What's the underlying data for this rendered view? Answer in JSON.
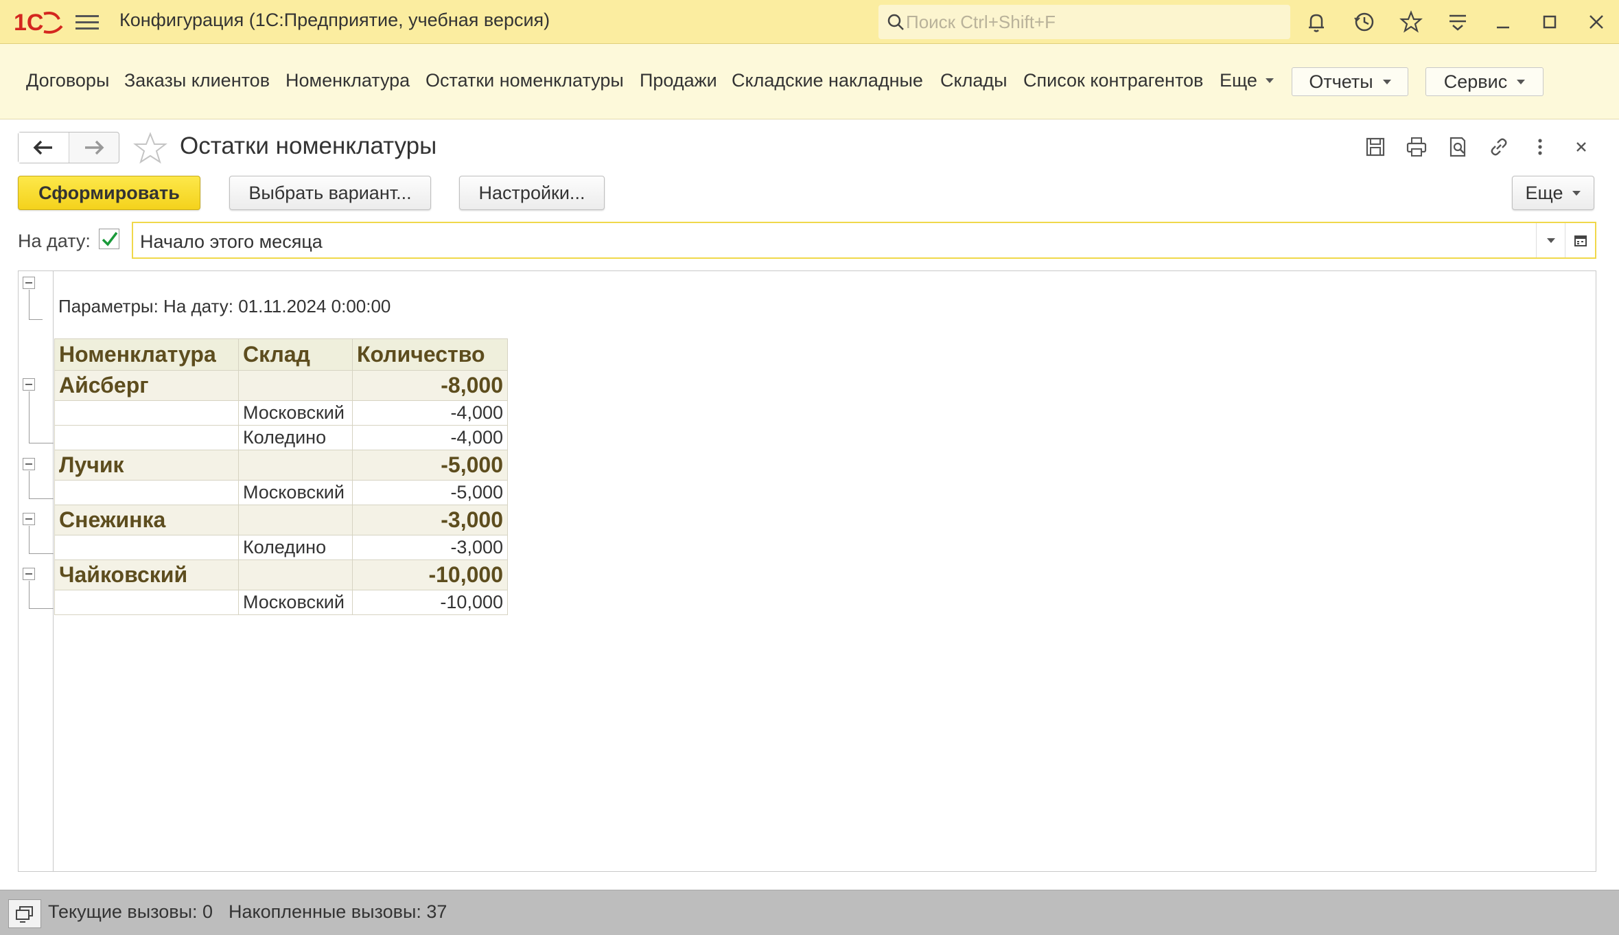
{
  "titlebar": {
    "logo_text": "1С",
    "app_title": "Конфигурация  (1С:Предприятие, учебная версия)",
    "search_placeholder": "Поиск Ctrl+Shift+F",
    "icons": [
      "bell-icon",
      "history-icon",
      "star-icon",
      "menu-lines-icon",
      "minimize-icon",
      "maximize-icon",
      "close-icon"
    ]
  },
  "sections": {
    "items": [
      "Договоры",
      "Заказы клиентов",
      "Номенклатура",
      "Остатки номенклатуры",
      "Продажи",
      "Складские накладные",
      "Склады",
      "Список контрагентов",
      "Еще"
    ],
    "reports_label": "Отчеты",
    "service_label": "Сервис"
  },
  "form": {
    "title": "Остатки номенклатуры",
    "generate_label": "Сформировать",
    "variant_label": "Выбрать вариант...",
    "settings_label": "Настройки...",
    "more_label": "Еще",
    "date_label": "На дату:",
    "date_checked": true,
    "date_value": "Начало этого месяца"
  },
  "report": {
    "params_text": "Параметры:  На дату: 01.11.2024 0:00:00",
    "headers": [
      "Номенклатура",
      "Склад",
      "Количество"
    ],
    "groups": [
      {
        "name": "Айсберг",
        "total": "-8,000",
        "rows": [
          {
            "warehouse": "Московский",
            "qty": "-4,000"
          },
          {
            "warehouse": "Коледино",
            "qty": "-4,000"
          }
        ]
      },
      {
        "name": "Лучик",
        "total": "-5,000",
        "rows": [
          {
            "warehouse": "Московский",
            "qty": "-5,000"
          }
        ]
      },
      {
        "name": "Снежинка",
        "total": "-3,000",
        "rows": [
          {
            "warehouse": "Коледино",
            "qty": "-3,000"
          }
        ]
      },
      {
        "name": "Чайковский",
        "total": "-10,000",
        "rows": [
          {
            "warehouse": "Московский",
            "qty": "-10,000"
          }
        ]
      }
    ]
  },
  "statusbar": {
    "current_calls": "Текущие вызовы: 0",
    "accumulated_calls": "Накопленные вызовы: 37"
  },
  "colors": {
    "titlebar_bg": "#fbeda0",
    "sections_bg": "#fdf9da",
    "primary_button": "#f4d21c",
    "table_header_bg": "#efefdc",
    "table_text_brown": "#5d4d1e",
    "logo_red": "#d4271f"
  }
}
